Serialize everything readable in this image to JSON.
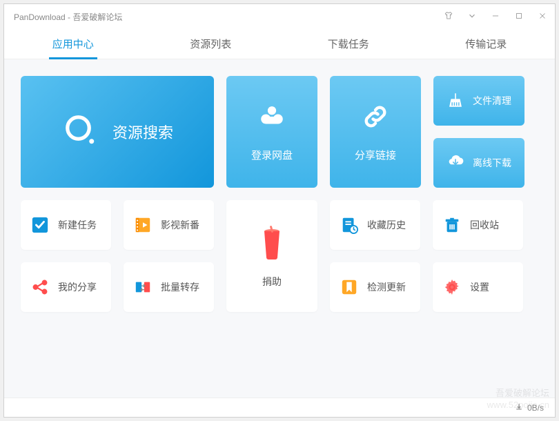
{
  "window": {
    "title": "PanDownload - 吾爱破解论坛"
  },
  "tabs": [
    {
      "label": "应用中心",
      "active": true
    },
    {
      "label": "资源列表",
      "active": false
    },
    {
      "label": "下载任务",
      "active": false
    },
    {
      "label": "传输记录",
      "active": false
    }
  ],
  "cards": {
    "search": "资源搜索",
    "login": "登录网盘",
    "share": "分享链接",
    "clean": "文件清理",
    "offline": "离线下载"
  },
  "tiles": {
    "newtask": "新建任务",
    "video": "影视新番",
    "donate": "捐助",
    "history": "收藏历史",
    "recycle": "回收站",
    "myshare": "我的分享",
    "batch": "批量转存",
    "update": "检测更新",
    "settings": "设置"
  },
  "statusbar": {
    "speed": "0B/s"
  },
  "watermark": {
    "line1": "吾爱破解论坛",
    "line2": "www.52pojie.cn"
  }
}
